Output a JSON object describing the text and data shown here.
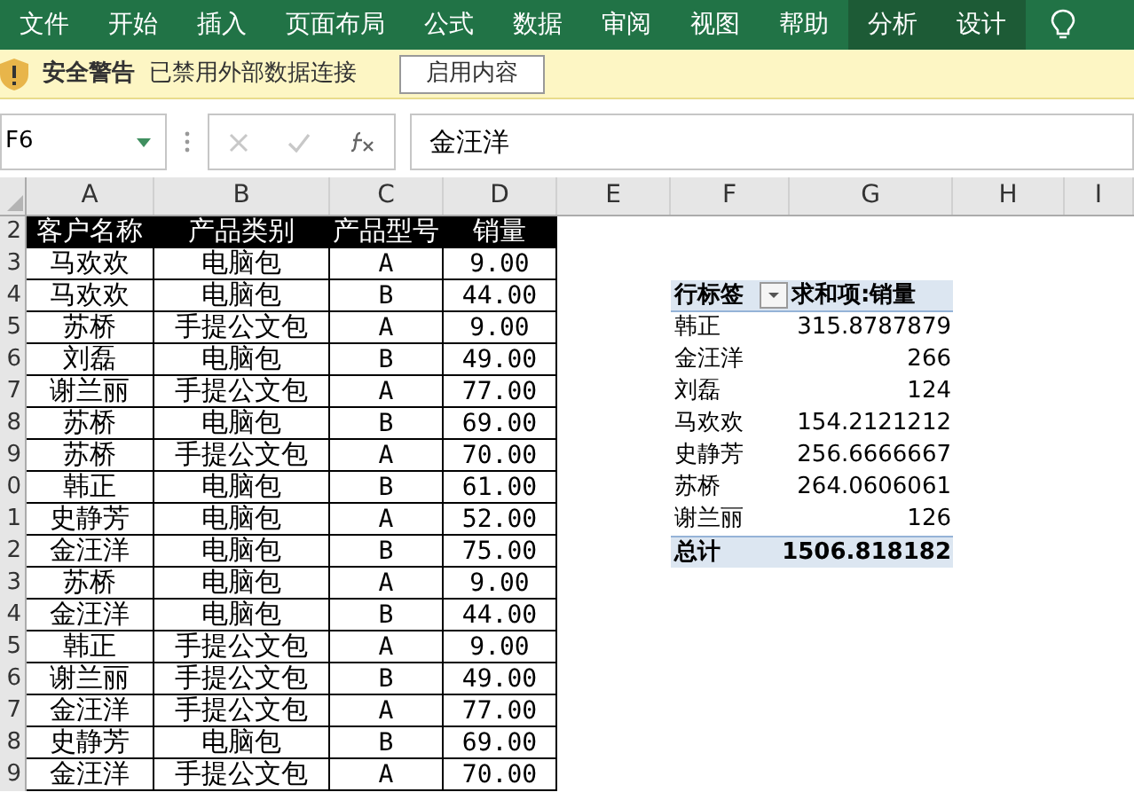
{
  "ribbon_tabs": [
    {
      "label": "文件",
      "selected": false
    },
    {
      "label": "开始",
      "selected": false
    },
    {
      "label": "插入",
      "selected": false
    },
    {
      "label": "页面布局",
      "selected": false
    },
    {
      "label": "公式",
      "selected": false
    },
    {
      "label": "数据",
      "selected": false
    },
    {
      "label": "审阅",
      "selected": false
    },
    {
      "label": "视图",
      "selected": false
    },
    {
      "label": "帮助",
      "selected": false
    },
    {
      "label": "分析",
      "selected": true
    },
    {
      "label": "设计",
      "selected": true
    }
  ],
  "security_bar": {
    "title": "安全警告",
    "message": "已禁用外部数据连接",
    "button": "启用内容"
  },
  "formula_bar": {
    "name_box": "F6",
    "formula": "金汪洋"
  },
  "columns": [
    "A",
    "B",
    "C",
    "D",
    "E",
    "F",
    "G",
    "H",
    "I"
  ],
  "row_numbers": [
    "2",
    "3",
    "4",
    "5",
    "6",
    "7",
    "8",
    "9",
    "0",
    "1",
    "2",
    "3",
    "4",
    "5",
    "6",
    "7",
    "8",
    "9"
  ],
  "table": {
    "header": [
      "客户名称",
      "产品类别",
      "产品型号",
      "销量"
    ],
    "rows": [
      [
        "马欢欢",
        "电脑包",
        "A",
        "9.00"
      ],
      [
        "马欢欢",
        "电脑包",
        "B",
        "44.00"
      ],
      [
        "苏桥",
        "手提公文包",
        "A",
        "9.00"
      ],
      [
        "刘磊",
        "电脑包",
        "B",
        "49.00"
      ],
      [
        "谢兰丽",
        "手提公文包",
        "A",
        "77.00"
      ],
      [
        "苏桥",
        "电脑包",
        "B",
        "69.00"
      ],
      [
        "苏桥",
        "手提公文包",
        "A",
        "70.00"
      ],
      [
        "韩正",
        "电脑包",
        "B",
        "61.00"
      ],
      [
        "史静芳",
        "电脑包",
        "A",
        "52.00"
      ],
      [
        "金汪洋",
        "电脑包",
        "B",
        "75.00"
      ],
      [
        "苏桥",
        "电脑包",
        "A",
        "9.00"
      ],
      [
        "金汪洋",
        "电脑包",
        "B",
        "44.00"
      ],
      [
        "韩正",
        "手提公文包",
        "A",
        "9.00"
      ],
      [
        "谢兰丽",
        "手提公文包",
        "B",
        "49.00"
      ],
      [
        "金汪洋",
        "手提公文包",
        "A",
        "77.00"
      ],
      [
        "史静芳",
        "电脑包",
        "B",
        "69.00"
      ],
      [
        "金汪洋",
        "手提公文包",
        "A",
        "70.00"
      ]
    ]
  },
  "pivot": {
    "header": [
      "行标签",
      "求和项:销量"
    ],
    "rows": [
      [
        "韩正",
        "315.8787879"
      ],
      [
        "金汪洋",
        "266"
      ],
      [
        "刘磊",
        "124"
      ],
      [
        "马欢欢",
        "154.2121212"
      ],
      [
        "史静芳",
        "256.6666667"
      ],
      [
        "苏桥",
        "264.0606061"
      ],
      [
        "谢兰丽",
        "126"
      ]
    ],
    "total": [
      "总计",
      "1506.818182"
    ]
  }
}
